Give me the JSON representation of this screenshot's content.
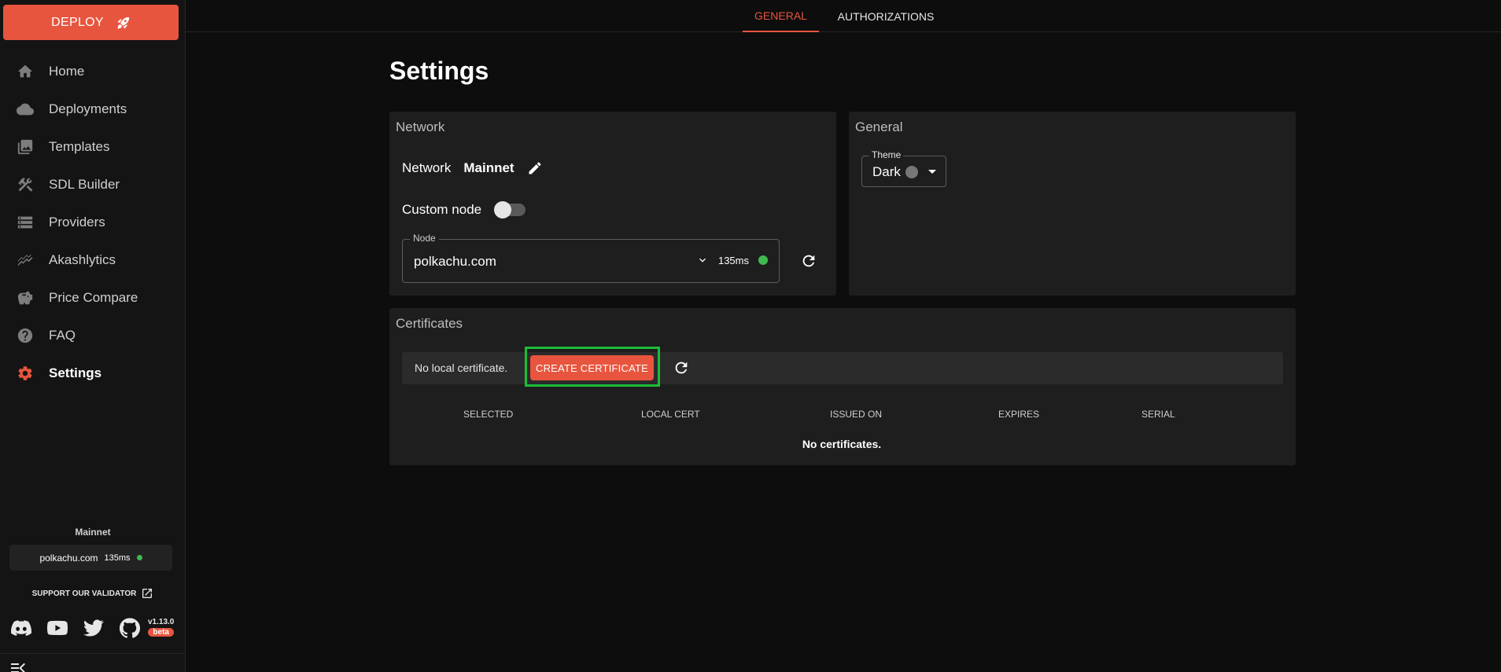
{
  "sidebar": {
    "deploy_label": "DEPLOY",
    "nav": [
      {
        "label": "Home",
        "icon": "home-icon"
      },
      {
        "label": "Deployments",
        "icon": "cloud-icon"
      },
      {
        "label": "Templates",
        "icon": "collections-icon"
      },
      {
        "label": "SDL Builder",
        "icon": "build-tools-icon"
      },
      {
        "label": "Providers",
        "icon": "storage-icon"
      },
      {
        "label": "Akashlytics",
        "icon": "analytics-icon"
      },
      {
        "label": "Price Compare",
        "icon": "piggy-bank-icon"
      },
      {
        "label": "FAQ",
        "icon": "help-icon"
      },
      {
        "label": "Settings",
        "icon": "gear-icon"
      }
    ],
    "network": "Mainnet",
    "node": "polkachu.com",
    "latency": "135ms",
    "support": "SUPPORT OUR VALIDATOR",
    "version": "v1.13.0",
    "beta": "beta"
  },
  "tabs": [
    "GENERAL",
    "AUTHORIZATIONS"
  ],
  "page_title": "Settings",
  "network_card": {
    "title": "Network",
    "network_label": "Network",
    "network_value": "Mainnet",
    "custom_node_label": "Custom node",
    "node_legend": "Node",
    "node_value": "polkachu.com",
    "latency": "135ms"
  },
  "general_card": {
    "title": "General",
    "theme_legend": "Theme",
    "theme_value": "Dark"
  },
  "certificates_card": {
    "title": "Certificates",
    "no_local": "No local certificate.",
    "create_label": "CREATE CERTIFICATE",
    "columns": [
      "SELECTED",
      "LOCAL CERT",
      "ISSUED ON",
      "EXPIRES",
      "SERIAL"
    ],
    "empty": "No certificates."
  },
  "colors": {
    "accent": "#e8553e",
    "status_ok": "#3fb950",
    "highlight": "#1bbd3a"
  }
}
